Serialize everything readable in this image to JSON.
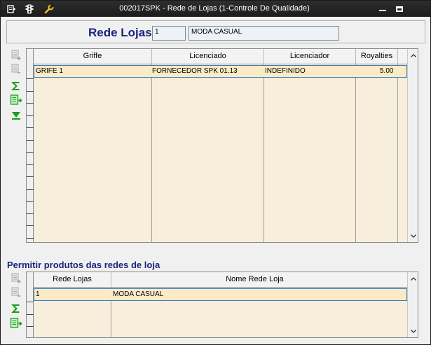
{
  "window": {
    "title": "002017SPK - Rede de Lojas (1-Controle De Qualidade)",
    "colors": {
      "titlebar": "#222222",
      "accent": "#1a237e",
      "grid_bg": "#f7eedb",
      "selection": "#3c78c8"
    }
  },
  "titlebar_icons": [
    "menu-icon",
    "traffic-light-icon",
    "wrench-icon"
  ],
  "header": {
    "label": "Rede Lojas",
    "code": "1",
    "name": "MODA CASUAL"
  },
  "griffes_grid": {
    "columns": [
      "Griffe",
      "Licenciado",
      "Licenciador",
      "Royalties"
    ],
    "rows": [
      {
        "griffe": "GRIFE 1",
        "licenciado": "FORNECEDOR SPK 01.13",
        "licenciador": "INDEFINIDO",
        "royalties": "5.00"
      }
    ]
  },
  "permit_section": {
    "title": "Permitir produtos das redes de loja",
    "columns": [
      "Rede Lojas",
      "Nome Rede Loja"
    ],
    "rows": [
      {
        "rede_lojas": "1",
        "nome": "MODA CASUAL"
      }
    ]
  }
}
